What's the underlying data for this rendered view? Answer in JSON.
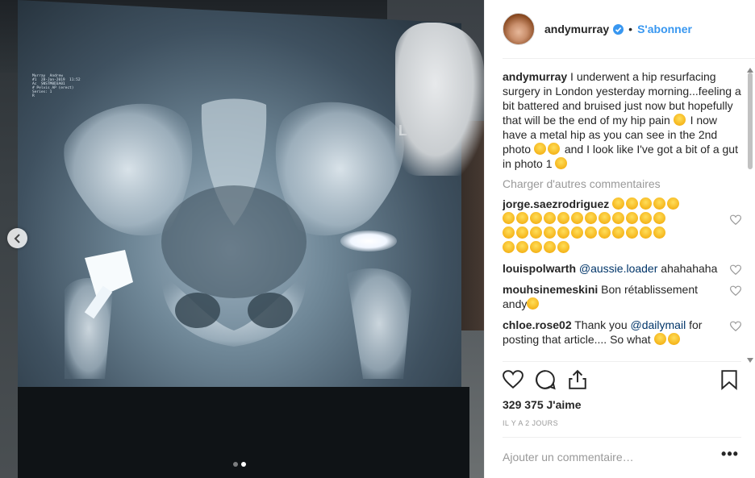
{
  "post": {
    "username": "andymurray",
    "follow_label": "S'abonner",
    "separator": "•",
    "caption_user": "andymurray",
    "caption_text": " I underwent a hip resurfacing surgery in London yesterday morning...feeling a bit battered and bruised just now but hopefully that will be the end of my hip pain ",
    "caption_text_2": " I now have a metal hip as you can see in the 2nd photo ",
    "caption_text_3": " and I look like I've got a bit of a gut in photo 1 ",
    "load_more": "Charger d'autres commentaires",
    "likes": "329 375 J'aime",
    "timestamp": "IL Y A 2 JOURS",
    "comment_placeholder": "Ajouter un commentaire…",
    "more_label": "•••"
  },
  "xray": {
    "label_text": "Murray  Andrew\n#1  28-Jan-2019  11:52\nAc  SNSTM0D3A01\n# Pelvis AP (erect)\nSeries: 1\nR",
    "side_marker": "L"
  },
  "comments": [
    {
      "user": "jorge.saezrodriguez",
      "mention": "",
      "text": " ",
      "emoji_count": 24
    },
    {
      "user": "louispolwarth",
      "mention": "@aussie.loader",
      "text": " ahahahaha",
      "emoji_count": 0
    },
    {
      "user": "mouhsinemeskini",
      "mention": "",
      "text": " Bon rétablissement andy",
      "emoji_count": 1
    },
    {
      "user": "chloe.rose02",
      "mention": "",
      "text": " Thank you ",
      "mention2": "@dailymail",
      "text2": " for posting that article.... So what ",
      "emoji_count": 2
    }
  ],
  "icons": {
    "prev": "chevron-left-icon",
    "verified": "verified-badge-icon",
    "like": "heart-icon",
    "comment": "comment-icon",
    "share": "share-icon",
    "save": "bookmark-icon"
  },
  "colors": {
    "accent": "#3897f0",
    "mention": "#003569",
    "muted": "#999999"
  }
}
